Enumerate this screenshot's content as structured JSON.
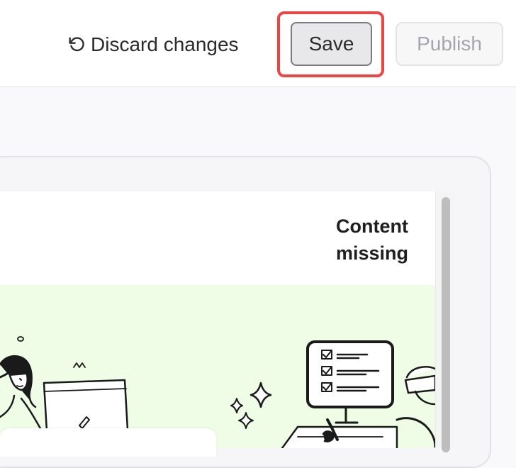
{
  "toolbar": {
    "discard_label": "Discard changes",
    "save_label": "Save",
    "publish_label": "Publish"
  },
  "preview": {
    "content_missing": "Content missing"
  },
  "colors": {
    "highlight": "#ef4444",
    "hero_bg": "#effde6",
    "publish_disabled_text": "#a5a5ad"
  },
  "icons": {
    "discard": "undo-icon"
  }
}
